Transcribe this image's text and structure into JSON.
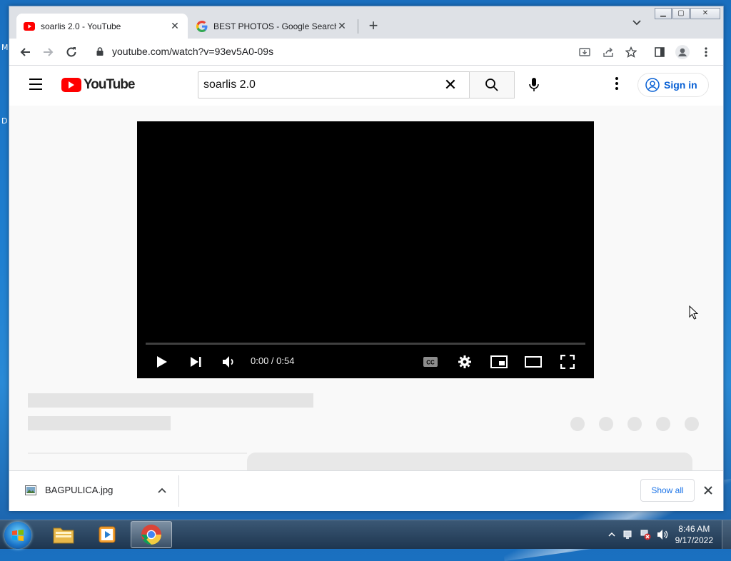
{
  "desktop": {
    "letters": [
      "M",
      "D"
    ]
  },
  "browser": {
    "tabs": [
      {
        "title": "soarlis 2.0 - YouTube",
        "favicon": "youtube-favicon",
        "active": true
      },
      {
        "title": "BEST PHOTOS - Google Search",
        "favicon": "google-favicon",
        "active": false
      }
    ],
    "url": "youtube.com/watch?v=93ev5A0-09s"
  },
  "youtube": {
    "logo_text": "YouTube",
    "search_query": "soarlis 2.0",
    "sign_in": "Sign in",
    "player": {
      "time": "0:00 / 0:54",
      "progress_fraction": 0
    }
  },
  "downloads": {
    "items": [
      {
        "filename": "BAGPULICA.jpg",
        "icon": "image-file-icon"
      }
    ],
    "show_all": "Show all"
  },
  "taskbar": {
    "items": [
      "file-explorer",
      "media-player",
      "google-chrome"
    ],
    "active": "google-chrome",
    "time": "8:46 AM",
    "date": "9/17/2022"
  },
  "colors": {
    "youtube_red": "#ff0000",
    "link_blue": "#065fd4",
    "chrome_blue": "#1a73e8"
  }
}
